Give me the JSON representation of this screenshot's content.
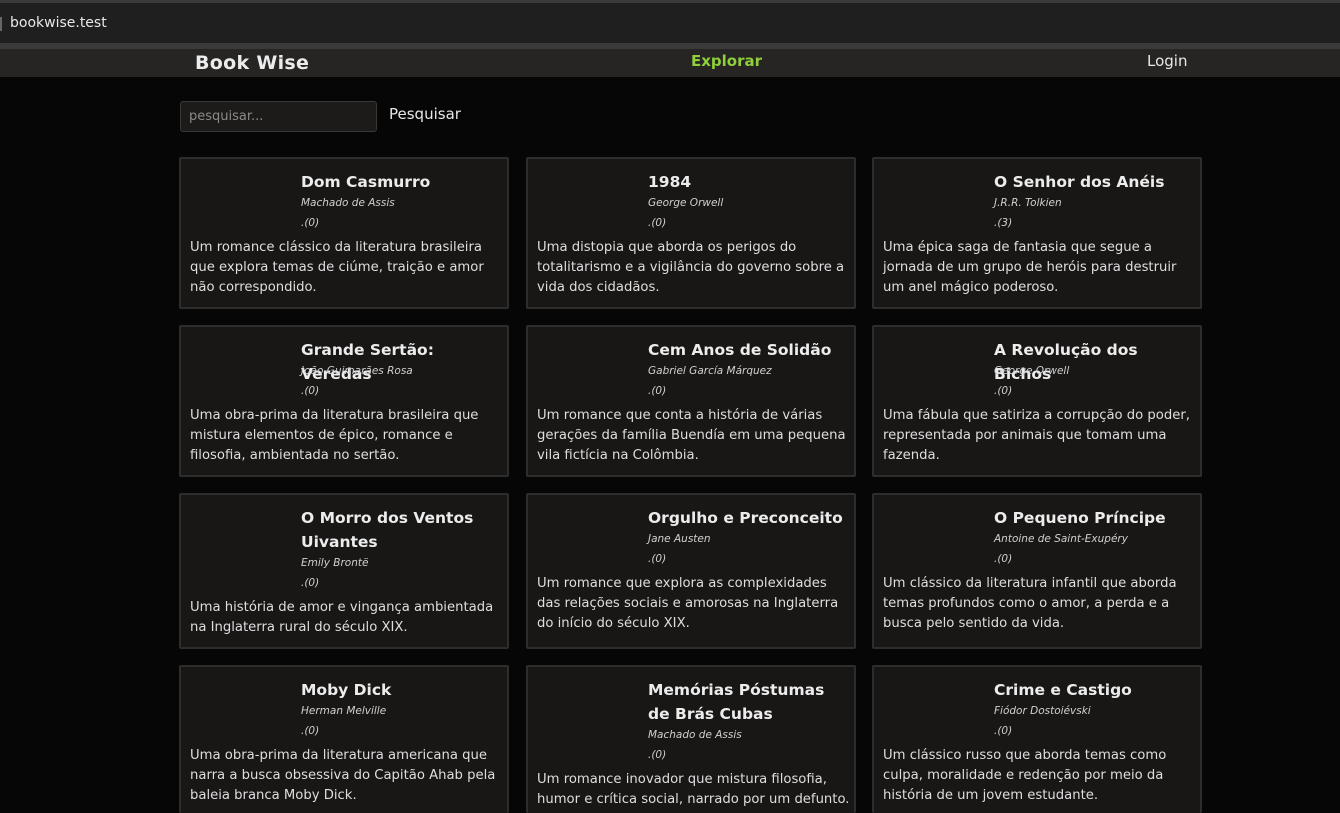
{
  "browser": {
    "url": "bookwise.test"
  },
  "nav": {
    "brand": "Book Wise",
    "explore": "Explorar",
    "login": "Login"
  },
  "search": {
    "placeholder": "pesquisar...",
    "button": "Pesquisar"
  },
  "books": [
    {
      "title": "Dom Casmurro",
      "author": "Machado de Assis",
      "rating": ".(0)",
      "description": "Um romance clássico da literatura brasileira que explora temas de ciúme, traição e amor não correspondido."
    },
    {
      "title": "1984",
      "author": "George Orwell",
      "rating": ".(0)",
      "description": "Uma distopia que aborda os perigos do totalitarismo e a vigilância do governo sobre a vida dos cidadãos."
    },
    {
      "title": "O Senhor dos Anéis",
      "author": "J.R.R. Tolkien",
      "rating": ".(3)",
      "description": "Uma épica saga de fantasia que segue a jornada de um grupo de heróis para destruir um anel mágico poderoso."
    },
    {
      "title": "Grande Sertão: Veredas",
      "author": "João Guimarães Rosa",
      "rating": ".(0)",
      "description": "Uma obra-prima da literatura brasileira que mistura elementos de épico, romance e filosofia, ambientada no sertão."
    },
    {
      "title": "Cem Anos de Solidão",
      "author": "Gabriel García Márquez",
      "rating": ".(0)",
      "description": "Um romance que conta a história de várias gerações da família Buendía em uma pequena vila fictícia na Colômbia."
    },
    {
      "title": "A Revolução dos Bichos",
      "author": "George Orwell",
      "rating": ".(0)",
      "description": "Uma fábula que satiriza a corrupção do poder, representada por animais que tomam uma fazenda."
    },
    {
      "title": "O Morro dos Ventos Uivantes",
      "author": "Emily Brontë",
      "rating": ".(0)",
      "description": "Uma história de amor e vingança ambientada na Inglaterra rural do século XIX."
    },
    {
      "title": "Orgulho e Preconceito",
      "author": "Jane Austen",
      "rating": ".(0)",
      "description": "Um romance que explora as complexidades das relações sociais e amorosas na Inglaterra do início do século XIX."
    },
    {
      "title": "O Pequeno Príncipe",
      "author": "Antoine de Saint-Exupéry",
      "rating": ".(0)",
      "description": "Um clássico da literatura infantil que aborda temas profundos como o amor, a perda e a busca pelo sentido da vida."
    },
    {
      "title": "Moby Dick",
      "author": "Herman Melville",
      "rating": ".(0)",
      "description": "Uma obra-prima da literatura americana que narra a busca obsessiva do Capitão Ahab pela baleia branca Moby Dick."
    },
    {
      "title": "Memórias Póstumas de Brás Cubas",
      "author": "Machado de Assis",
      "rating": ".(0)",
      "description": "Um romance inovador que mistura filosofia, humor e crítica social, narrado por um defunto."
    },
    {
      "title": "Crime e Castigo",
      "author": "Fiódor Dostoiévski",
      "rating": ".(0)",
      "description": "Um clássico russo que aborda temas como culpa, moralidade e redenção por meio da história de um jovem estudante."
    }
  ]
}
